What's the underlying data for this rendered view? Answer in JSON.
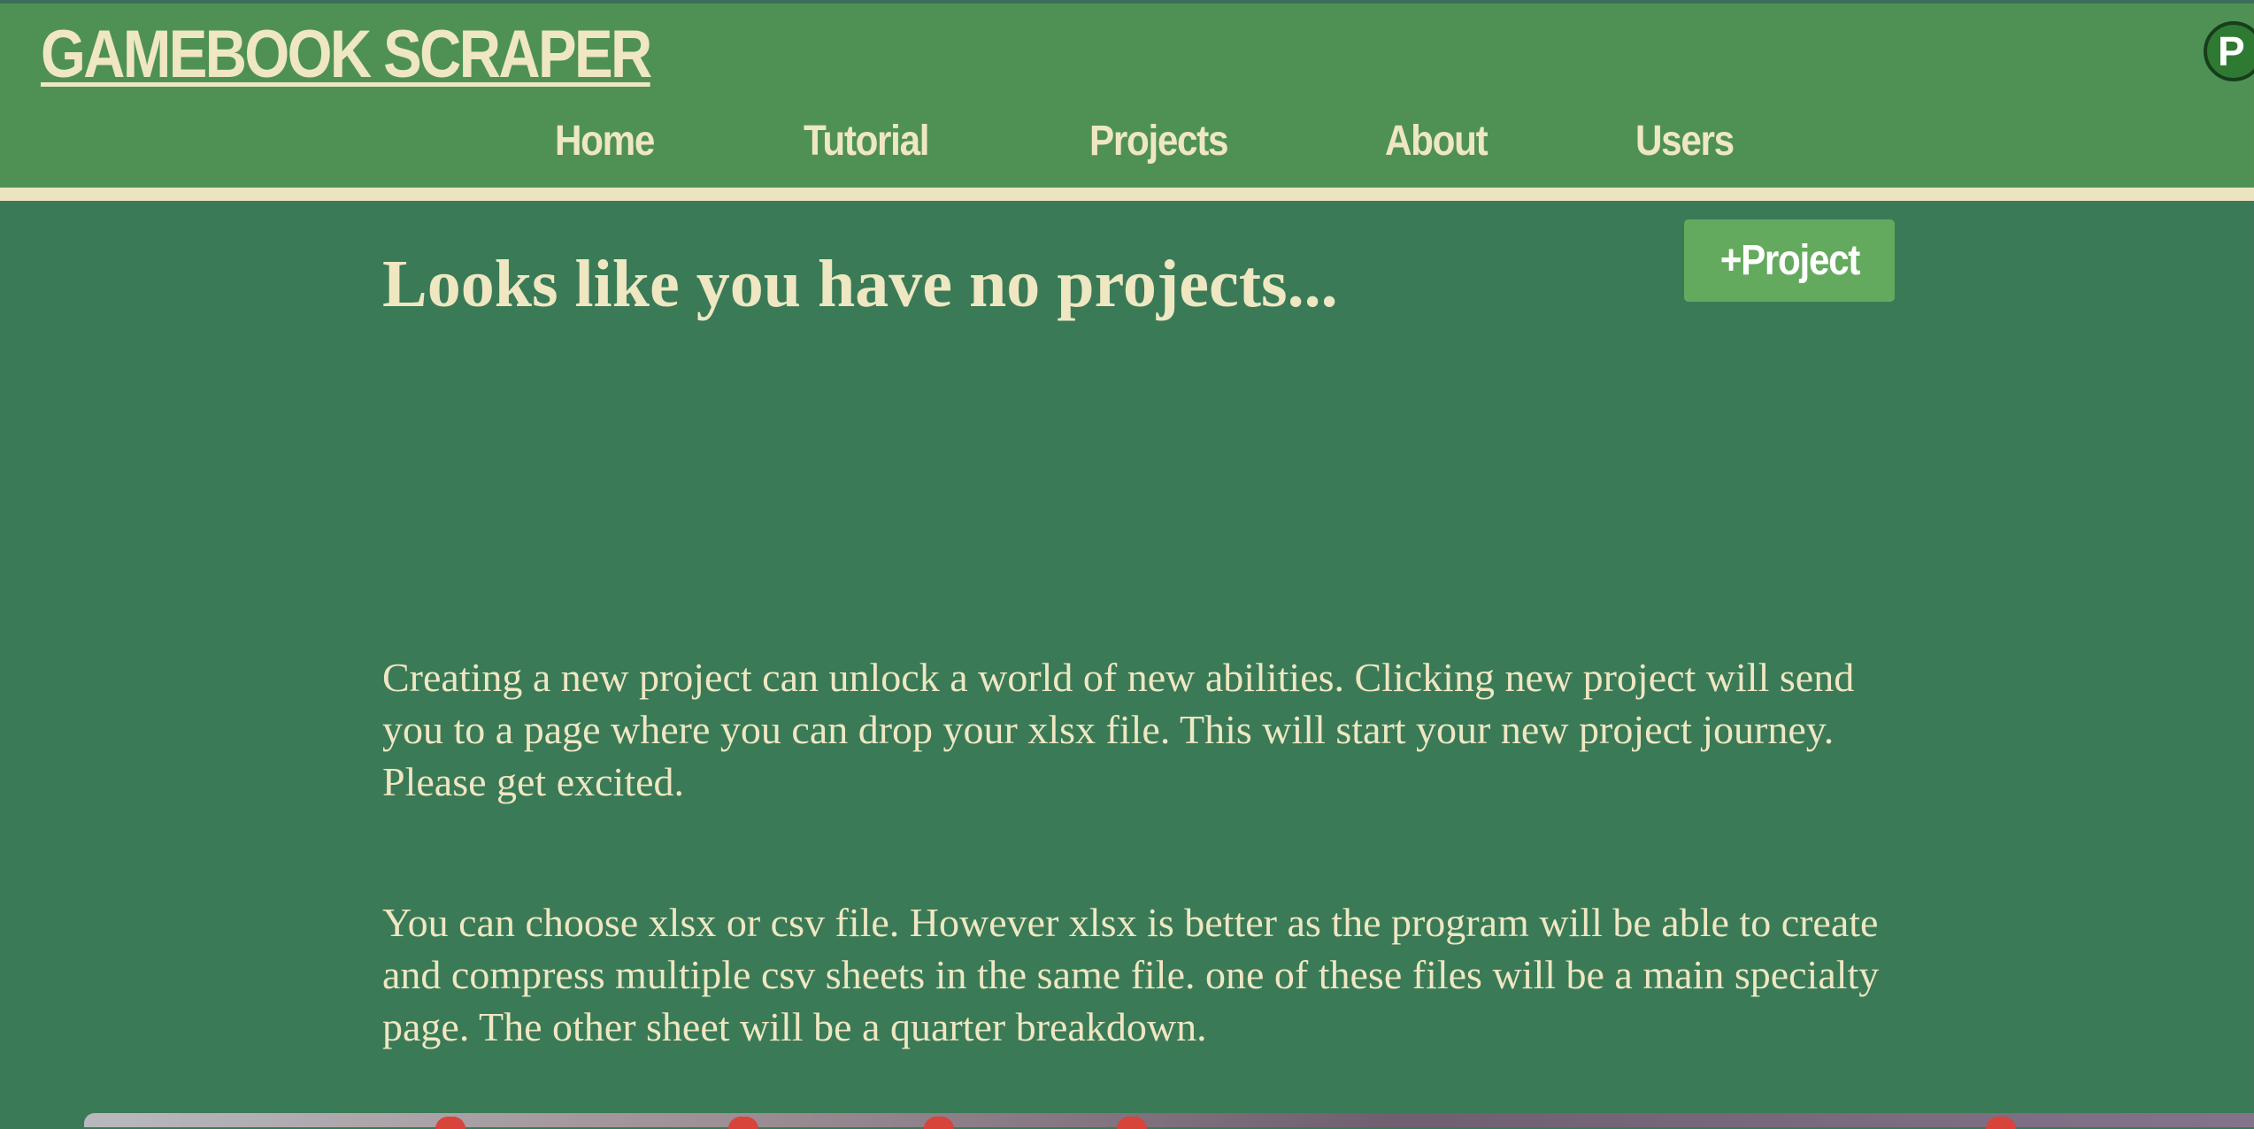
{
  "app": {
    "title": "GAMEBOOK SCRAPER"
  },
  "nav": {
    "items": [
      {
        "label": "Home"
      },
      {
        "label": "Tutorial"
      },
      {
        "label": "Projects"
      },
      {
        "label": "About"
      },
      {
        "label": "Users"
      }
    ]
  },
  "user": {
    "avatar_initial": "P"
  },
  "main": {
    "heading": "Looks like you have no projects...",
    "add_project_label": "+Project",
    "paragraphs": [
      "Creating a new project can unlock a world of new abilities. Clicking new project will send you to a page where you can drop your xlsx file. This will start your new project journey. Please get excited.",
      "You can choose xlsx or csv file. However xlsx is better as the program will be able to create and compress multiple csv sheets in the same file. one of these files will be a main specialty page. The other sheet will be a quarter breakdown."
    ]
  },
  "colors": {
    "page_background": "#3a7a57",
    "header_background": "#4f9154",
    "cream_text": "#efe7c2",
    "button_background": "#64aa5e",
    "avatar_background": "#2f7a32"
  }
}
